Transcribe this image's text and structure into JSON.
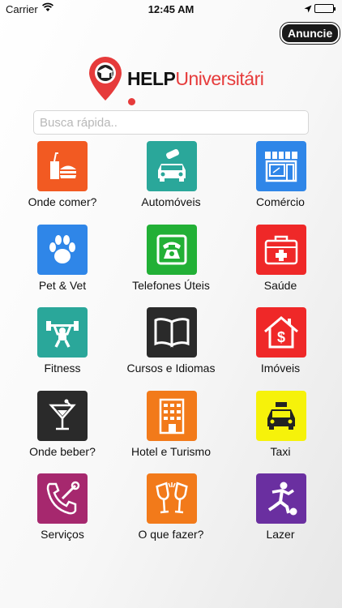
{
  "status_bar": {
    "carrier": "Carrier",
    "time": "12:45 AM"
  },
  "header": {
    "announce_label": "Anuncie",
    "logo_help": "HELP",
    "logo_uni": "Universitári"
  },
  "search": {
    "placeholder": "Busca rápida.."
  },
  "categories": [
    {
      "label": "Onde comer?",
      "icon": "fast-food-icon",
      "color": "#f25a22"
    },
    {
      "label": "Automóveis",
      "icon": "car-icon",
      "color": "#2aa79a"
    },
    {
      "label": "Comércio",
      "icon": "storefront-icon",
      "color": "#2f86e8"
    },
    {
      "label": "Pet & Vet",
      "icon": "paw-icon",
      "color": "#2f86e8"
    },
    {
      "label": "Telefones Úteis",
      "icon": "telephone-icon",
      "color": "#22b036"
    },
    {
      "label": "Saúde",
      "icon": "first-aid-kit-icon",
      "color": "#ef2828"
    },
    {
      "label": "Fitness",
      "icon": "weightlifter-icon",
      "color": "#2aa79a"
    },
    {
      "label": "Cursos e Idiomas",
      "icon": "book-icon",
      "color": "#2a2a2a"
    },
    {
      "label": "Imóveis",
      "icon": "house-dollar-icon",
      "color": "#ef2828"
    },
    {
      "label": "Onde beber?",
      "icon": "cocktail-icon",
      "color": "#2a2a2a"
    },
    {
      "label": "Hotel e Turismo",
      "icon": "hotel-building-icon",
      "color": "#f27a1a"
    },
    {
      "label": "Taxi",
      "icon": "taxi-icon",
      "color": "#f6f20a"
    },
    {
      "label": "Serviços",
      "icon": "phone-wrench-icon",
      "color": "#a6286e"
    },
    {
      "label": "O que fazer?",
      "icon": "toast-glasses-icon",
      "color": "#f27a1a"
    },
    {
      "label": "Lazer",
      "icon": "soccer-player-icon",
      "color": "#6a2fa0"
    }
  ]
}
